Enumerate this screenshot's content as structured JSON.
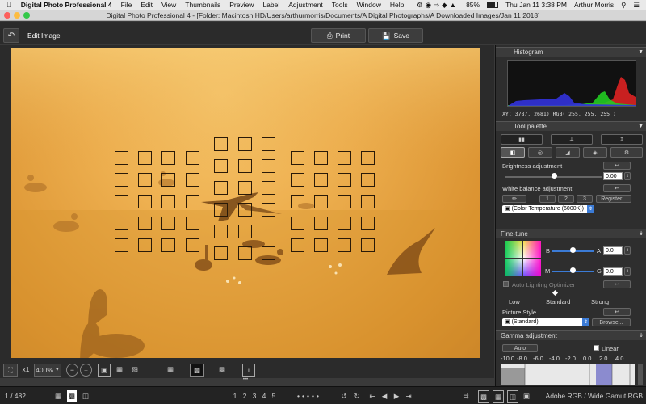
{
  "menubar": {
    "app_name": "Digital Photo Professional 4",
    "items": [
      "File",
      "Edit",
      "View",
      "Thumbnails",
      "Preview",
      "Label",
      "Adjustment",
      "Tools",
      "Window",
      "Help"
    ],
    "battery": "85%",
    "datetime": "Thu Jan 11  3:38 PM",
    "user": "Arthur Morris"
  },
  "window": {
    "title": "Digital Photo Professional 4 - [Folder: Macintosh HD/Users/arthurmorris/Documents/A Digital Photographs/A Downloaded Images/Jan 11 2018]"
  },
  "toolbar": {
    "mode_label": "Edit Image",
    "print_label": "Print",
    "save_label": "Save"
  },
  "zoombar": {
    "one_to_one": "x1",
    "zoom": "400%"
  },
  "status": {
    "counter": "1 / 482",
    "ratings": [
      "1",
      "2",
      "3",
      "4",
      "5"
    ],
    "color_space": "Adobe RGB / Wide Gamut RGB"
  },
  "histogram": {
    "title": "Histogram",
    "readout": "XY( 3787,  2681) RGB( 255, 255, 255 )"
  },
  "tool_palette": {
    "title": "Tool palette",
    "brightness_label": "Brightness adjustment",
    "brightness_value": "0.00",
    "brightness_level": 0.5,
    "wb_label": "White balance adjustment",
    "wb_buttons": [
      "1",
      "2",
      "3"
    ],
    "register_label": "Register...",
    "wb_select": "(Color Temperature (6000K))"
  },
  "fine_tune": {
    "title": "Fine-tune",
    "b_label": "B",
    "a_label": "A",
    "a_value": "0.0",
    "m_label": "M",
    "g_label": "G",
    "g_value": "0.0",
    "alo_label": "Auto Lighting Optimizer",
    "low": "Low",
    "standard": "Standard",
    "strong": "Strong"
  },
  "picture_style": {
    "label": "Picture Style",
    "select": "(Standard)",
    "browse": "Browse..."
  },
  "gamma": {
    "title": "Gamma adjustment",
    "auto": "Auto",
    "linear": "Linear",
    "ticks": [
      "-10.0",
      "-8.0",
      "-6.0",
      "-4.0",
      "-2.0",
      "0.0",
      "2.0",
      "4.0"
    ]
  },
  "colors": {
    "accent": "#3b7bd6",
    "panel": "#2e2e2e",
    "photo_gold": "#eeb050"
  }
}
